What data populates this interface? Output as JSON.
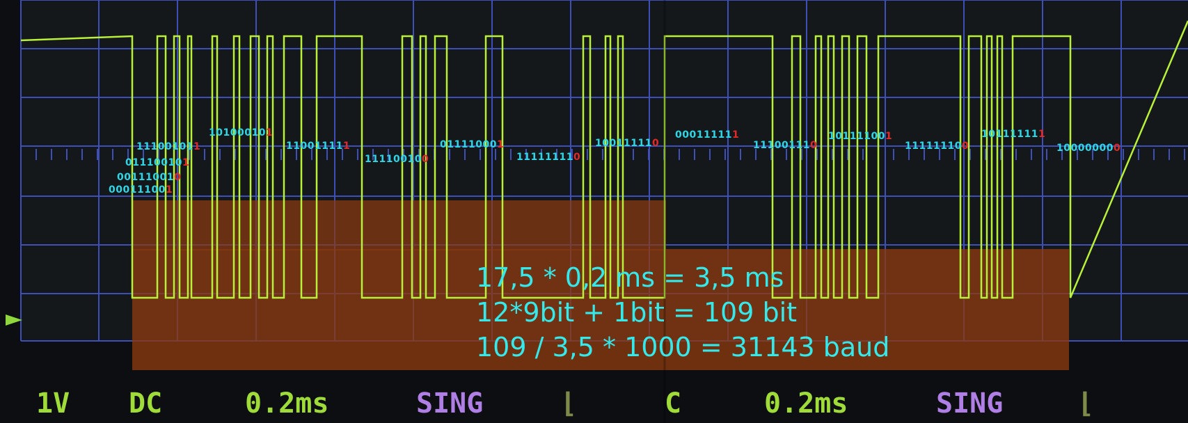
{
  "colors": {
    "screen_bg": "#0c0e11",
    "grid": "#3f4fb8",
    "trace": "#b8f03a",
    "bits_high": "#2fd6e6",
    "bits_low": "#e02a2a",
    "overlay": "#8a3a10",
    "overlay_text": "#35e8ea",
    "status_green": "#9fdc3a",
    "status_violet": "#b07fe6"
  },
  "decoded_bytes": [
    {
      "bits": "11100101",
      "last": "1"
    },
    {
      "bits": "01110010",
      "last": "1"
    },
    {
      "bits": "00111001",
      "last": "0"
    },
    {
      "bits": "00011100",
      "last": "1"
    },
    {
      "bits": "10100010",
      "last": "1"
    },
    {
      "bits": "11001111",
      "last": "1"
    },
    {
      "bits": "11110010",
      "last": "0"
    },
    {
      "bits": "01111000",
      "last": "1"
    },
    {
      "bits": "11111111",
      "last": "0"
    },
    {
      "bits": "10011111",
      "last": "0"
    },
    {
      "bits": "00011111",
      "last": "1"
    },
    {
      "bits": "11100111",
      "last": "0"
    },
    {
      "bits": "10111100",
      "last": "1"
    },
    {
      "bits": "11111110",
      "last": "0"
    },
    {
      "bits": "10111111",
      "last": "1"
    },
    {
      "bits": "10000000",
      "last": "0"
    }
  ],
  "calculation": {
    "line1": "17,5 * 0,2 ms = 3,5 ms",
    "line2": "12*9bit + 1bit = 109 bit",
    "line3": "109 / 3,5  * 1000 = 31143 baud"
  },
  "status_bar": {
    "volts_div": "1V",
    "coupling": "DC",
    "time_div_left": "0.2ms",
    "mode_left": "SING",
    "trigger_slope_left": "⌊",
    "coupling_right": "C",
    "time_div_right": "0.2ms",
    "mode_right": "SING",
    "trigger_slope_right": "⌊"
  }
}
